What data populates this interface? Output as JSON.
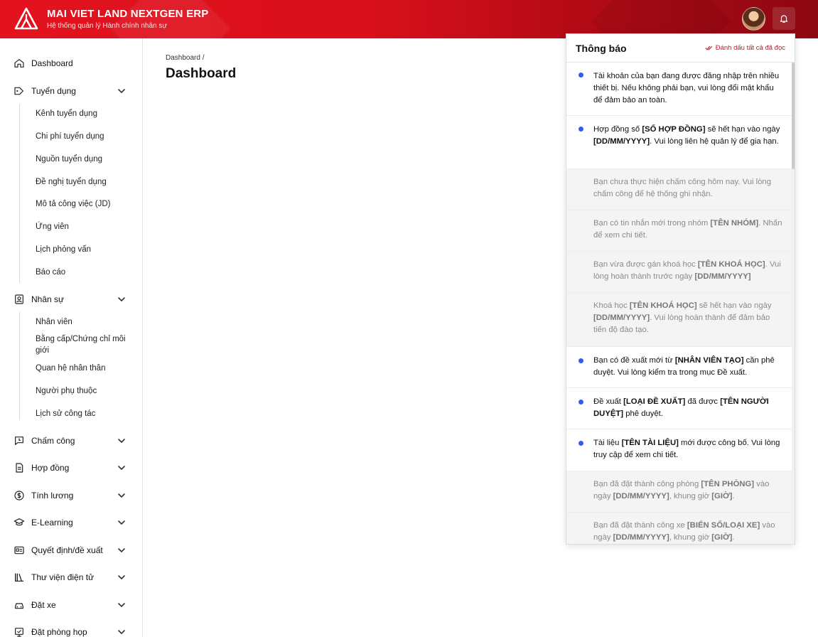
{
  "header": {
    "brand_title": "MAI VIET LAND NEXTGEN ERP",
    "brand_subtitle": "Hệ thống quản lý Hành chính nhân sự",
    "accent": "#e3121e"
  },
  "sidebar": {
    "items": [
      {
        "label": "Dashboard",
        "icon": "home-icon"
      },
      {
        "label": "Tuyển dụng",
        "icon": "tag-icon",
        "children": [
          "Kênh tuyển dụng",
          "Chi phí tuyển dụng",
          "Nguồn tuyển dụng",
          "Đề nghị tuyển dụng",
          "Mô tả công việc (JD)",
          "Ứng viên",
          "Lịch phỏng vấn",
          "Báo cáo"
        ]
      },
      {
        "label": "Nhân sự",
        "icon": "contact-icon",
        "children": [
          "Nhân viên",
          "Bằng cấp/Chứng chỉ môi giới",
          "Quan hệ nhân thân",
          "Người phụ thuộc",
          "Lịch sử công tác"
        ]
      },
      {
        "label": "Chấm công",
        "icon": "timesheet-icon"
      },
      {
        "label": "Hợp đồng",
        "icon": "contract-icon"
      },
      {
        "label": "Tính lương",
        "icon": "dollar-icon"
      },
      {
        "label": "E-Learning",
        "icon": "graduation-cap-icon"
      },
      {
        "label": "Quyết định/đề xuất",
        "icon": "id-card-icon"
      },
      {
        "label": "Thư viện điện tử",
        "icon": "library-icon"
      },
      {
        "label": "Đặt xe",
        "icon": "car-icon"
      },
      {
        "label": "Đặt phòng họp",
        "icon": "meeting-room-icon"
      }
    ]
  },
  "main": {
    "breadcrumb": "Dashboard /",
    "title": "Dashboard"
  },
  "notifications": {
    "title": "Thông báo",
    "mark_all_read": "Đánh dấu tất cả đã đọc",
    "unread_color": "#2f5ee9",
    "items": [
      {
        "unread": true,
        "parts": [
          {
            "t": "Tài khoản của bạn đang được đăng nhập trên nhiều thiết bị. Nếu không phải bạn, vui lòng đổi mật khẩu để đảm bảo an toàn."
          }
        ]
      },
      {
        "unread": true,
        "parts": [
          {
            "t": "Hợp đồng số "
          },
          {
            "t": "[SỐ HỢP ĐỒNG]",
            "b": true
          },
          {
            "t": " sẽ hết hạn vào ngày "
          },
          {
            "t": "[DD/MM/YYYY]",
            "b": true
          },
          {
            "t": ". Vui lòng liên hệ quản lý để gia hạn."
          }
        ]
      },
      {
        "unread": false,
        "parts": [
          {
            "t": "Bạn chưa thực hiện chấm công hôm nay. Vui lòng chấm công để hệ thống ghi nhận."
          }
        ]
      },
      {
        "unread": false,
        "parts": [
          {
            "t": "Bạn có tin nhắn mới trong nhóm "
          },
          {
            "t": "[TÊN NHÓM]",
            "b": true
          },
          {
            "t": ". Nhấn để xem chi tiết."
          }
        ]
      },
      {
        "unread": false,
        "parts": [
          {
            "t": "Bạn vừa được gán khoá học "
          },
          {
            "t": "[TÊN KHOÁ HỌC]",
            "b": true
          },
          {
            "t": ". Vui lòng hoàn thành trước ngày "
          },
          {
            "t": "[DD/MM/YYYY]",
            "b": true
          }
        ]
      },
      {
        "unread": false,
        "parts": [
          {
            "t": "Khoá học "
          },
          {
            "t": "[TÊN KHOÁ HỌC]",
            "b": true
          },
          {
            "t": " sẽ hết hạn vào ngày "
          },
          {
            "t": "[DD/MM/YYYY]",
            "b": true
          },
          {
            "t": ". Vui lòng hoàn thành để đảm bảo tiến độ đào tạo."
          }
        ]
      },
      {
        "unread": true,
        "parts": [
          {
            "t": "Bạn có đề xuất mới từ "
          },
          {
            "t": "[NHÂN VIÊN TẠO]",
            "b": true
          },
          {
            "t": " cần phê duyệt. Vui lòng kiểm tra trong mục Đề xuất."
          }
        ]
      },
      {
        "unread": true,
        "parts": [
          {
            "t": "Đề xuất "
          },
          {
            "t": "[LOẠI ĐỀ XUẤT]",
            "b": true
          },
          {
            "t": " đã được "
          },
          {
            "t": "[TÊN NGƯỜI DUYỆT]",
            "b": true
          },
          {
            "t": " phê duyệt."
          }
        ]
      },
      {
        "unread": true,
        "parts": [
          {
            "t": "Tài liệu "
          },
          {
            "t": "[TÊN TÀI LIỆU]",
            "b": true
          },
          {
            "t": " mới được công bố. Vui lòng truy cập để xem chi tiết."
          }
        ]
      },
      {
        "unread": false,
        "parts": [
          {
            "t": "Bạn đã đặt thành công phòng "
          },
          {
            "t": "[TÊN PHÒNG]",
            "b": true
          },
          {
            "t": " vào ngày "
          },
          {
            "t": "[DD/MM/YYYY]",
            "b": true
          },
          {
            "t": ", khung giờ "
          },
          {
            "t": "[GIỜ]",
            "b": true
          },
          {
            "t": "."
          }
        ]
      },
      {
        "unread": false,
        "parts": [
          {
            "t": "Bạn đã đặt thành công xe "
          },
          {
            "t": "[BIỂN SỐ/LOẠI XE]",
            "b": true
          },
          {
            "t": " vào ngày "
          },
          {
            "t": "[DD/MM/YYYY]",
            "b": true
          },
          {
            "t": ", khung giờ "
          },
          {
            "t": "[GIỜ]",
            "b": true
          },
          {
            "t": "."
          }
        ]
      }
    ]
  }
}
